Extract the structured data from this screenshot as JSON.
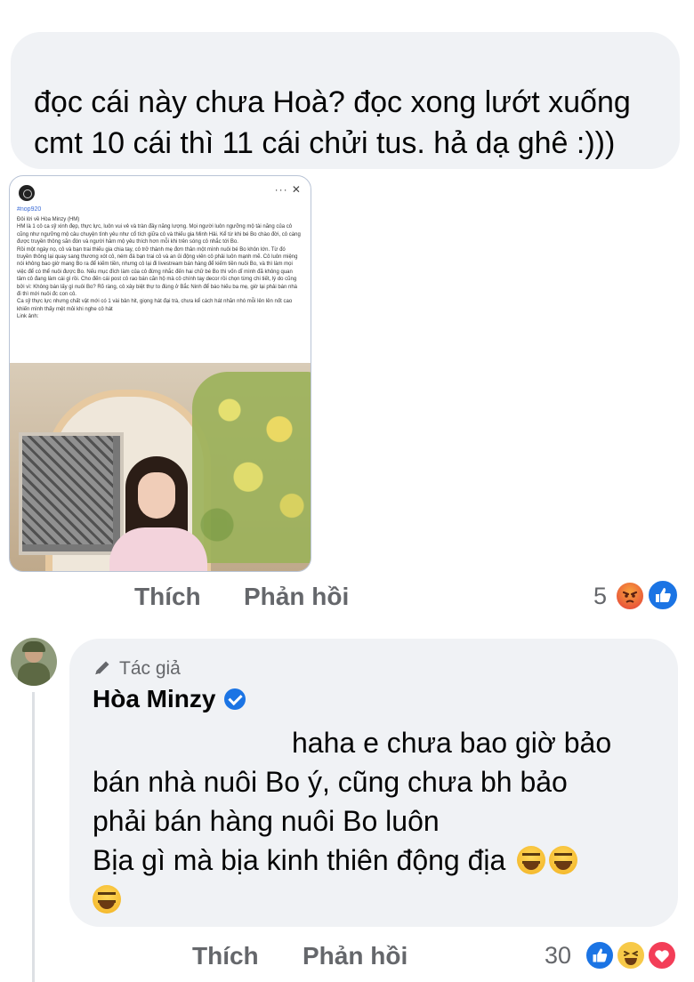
{
  "comment": {
    "text": "đọc cái này chưa Hoà? đọc xong lướt xuống cmt 10 cái thì 11 cái chửi tus. hả dạ ghê :)))"
  },
  "attachment": {
    "hashtag": "#nop920",
    "body": "Đôi lời về Hòa Minzy (HM)\nHM là 1 cô ca sỹ xinh đẹp, thực lực, luôn vui vẻ và tràn đầy năng lượng. Mọi người luôn ngưỡng mộ tài năng của cô cũng như ngưỡng mộ câu chuyện tình yêu như cổ tích giữa cô và thiếu gia Minh Hải. Kể từ khi bé Bo chào đời, cô càng được truyền thông săn đón và người hâm mộ yêu thích hơn mỗi khi trên sóng cô nhắc tới Bo.\nRồi một ngày nọ, cô và bạn trai thiếu gia chia tay, cô trở thành mẹ đơn thân một mình nuôi bé Bo khôn lớn. Từ đó truyền thông lại quay sang thương xót cô, ném đá bạn trai cô và an ủi động viên cô phải luôn mạnh mẽ. Cô luôn miệng nói không bao giờ mang Bo ra để kiếm tiền, nhưng cô lại đi livestream bán hàng để kiếm tiền nuôi Bo, và thì làm mọi việc để có thể nuôi được Bo. Nếu mục đích làm của cô đừng nhắc đến hai chữ bé Bo thì vốn dĩ mình đã không quan tâm cô đang làm cái gì rồi. Cho đến cái post cô rao bán căn hộ mà cô chính tay decor rồi chọn từng chi tiết, lý do cũng bởi vì: Không bán lấy gì nuôi Bo? Rõ ràng, cô xây biệt thự to đùng ở Bắc Ninh để báo hiếu ba mẹ, giờ lại phải bán nhà đi thì mới nuôi đc con cô.\nCa sỹ thực lực nhưng chất vật mới có 1 vài bản hit, giọng hát đại trà, chưa kể cách hát nhăn nhó mỗi lên lên nốt cao khiến mình thấy mệt mỏi khi nghe cô hát\nLink ảnh:",
    "menu_glyphs": "··· ✕"
  },
  "actions1": {
    "like": "Thích",
    "reply": "Phản hồi",
    "count": "5"
  },
  "reply": {
    "badge": "Tác giả",
    "author": "Hòa Minzy",
    "line1": "haha e chưa bao giờ bảo",
    "line2": "bán nhà nuôi Bo ý, cũng chưa bh bảo",
    "line3": "phải bán hàng nuôi Bo luôn",
    "line4": "Bịa gì mà bịa kinh thiên động địa"
  },
  "actions2": {
    "like": "Thích",
    "reply": "Phản hồi",
    "count": "30"
  },
  "colors": {
    "bubble": "#f0f2f5",
    "muted": "#65676b",
    "like_blue": "#1b74e4",
    "love_red": "#f33e58"
  },
  "icons": [
    "pencil-icon",
    "verified-badge-icon",
    "angry-reaction-icon",
    "like-reaction-icon",
    "haha-reaction-icon",
    "love-reaction-icon",
    "grinning-squinting-emoji"
  ]
}
